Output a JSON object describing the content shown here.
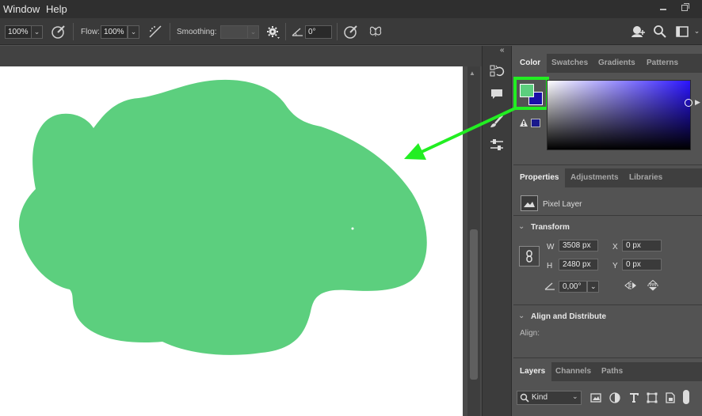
{
  "menubar": {
    "items": [
      "Window",
      "Help"
    ],
    "window_controls": [
      "minimize-icon",
      "restore-icon"
    ]
  },
  "options_bar": {
    "opacity_value": "100%",
    "flow_label": "Flow:",
    "flow_value": "100%",
    "smoothing_label": "Smoothing:",
    "smoothing_value": "",
    "angle_value": "0°",
    "right_icons": [
      "cloud-user-icon",
      "search-icon",
      "workspace-icon"
    ]
  },
  "color_panel": {
    "tabs": [
      "Color",
      "Swatches",
      "Gradients",
      "Patterns"
    ],
    "active_tab": "Color",
    "foreground_color": "#5ccf7e",
    "background_color": "#1a0fa8",
    "highlight_color": "#22ee22"
  },
  "properties_panel": {
    "tabs": [
      "Properties",
      "Adjustments",
      "Libraries"
    ],
    "active_tab": "Properties",
    "layer_type": "Pixel Layer",
    "transform_title": "Transform",
    "w_label": "W",
    "w_value": "3508 px",
    "h_label": "H",
    "h_value": "2480 px",
    "x_label": "X",
    "x_value": "0 px",
    "y_label": "Y",
    "y_value": "0 px",
    "angle_value": "0,00°",
    "align_title": "Align and Distribute",
    "align_label": "Align:"
  },
  "layers_panel": {
    "tabs": [
      "Layers",
      "Channels",
      "Paths"
    ],
    "active_tab": "Layers",
    "filter_value": "Kind"
  },
  "canvas": {
    "blob_color": "#5ccf7e",
    "background": "#ffffff"
  }
}
